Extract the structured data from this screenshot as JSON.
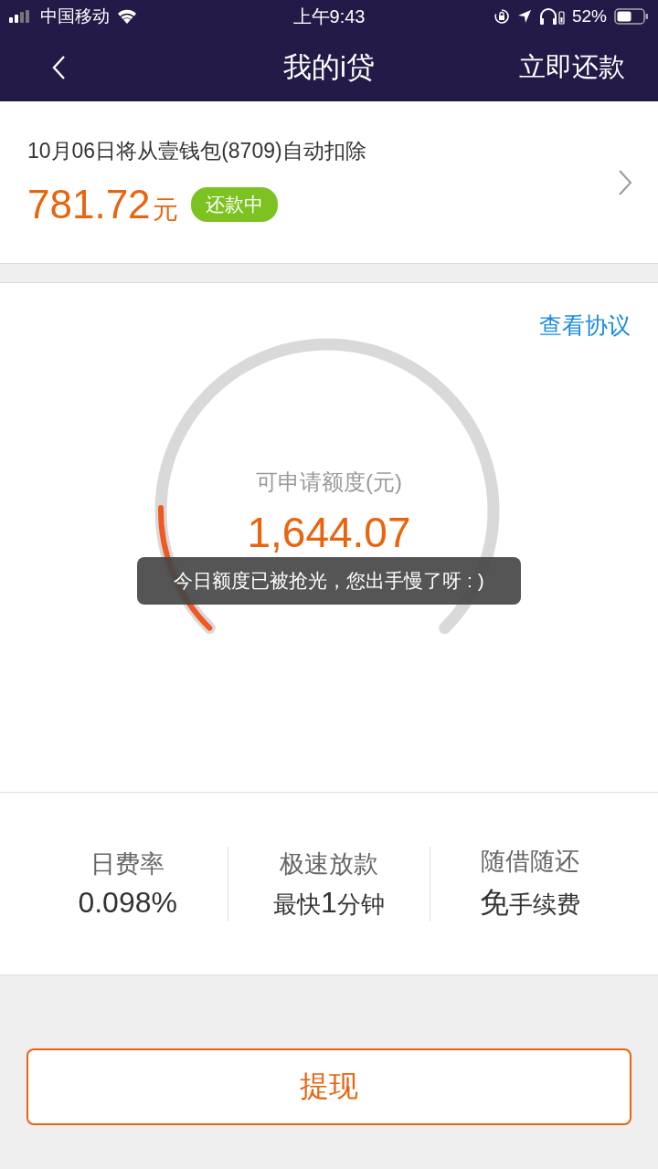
{
  "status_bar": {
    "carrier": "中国移动",
    "time": "上午9:43",
    "battery_percent": "52%"
  },
  "nav": {
    "title": "我的i贷",
    "action": "立即还款"
  },
  "repayment": {
    "notice": "10月06日将从壹钱包(8709)自动扣除",
    "amount": "781.72",
    "unit": "元",
    "status": "还款中"
  },
  "credit": {
    "agreement_link": "查看协议",
    "label": "可申请额度(元)",
    "amount": "1,644.07",
    "level": 0.17
  },
  "toast": "今日额度已被抢光，您出手慢了呀 : )",
  "features": [
    {
      "title": "日费率",
      "value": {
        "emphasis": "0.098%"
      }
    },
    {
      "title": "极速放款",
      "value": {
        "prefix": "最快",
        "emphasis": "1",
        "suffix": "分钟"
      }
    },
    {
      "title": "随借随还",
      "value": {
        "emphasis": "免",
        "suffix": "手续费"
      }
    }
  ],
  "withdraw_button": "提现"
}
